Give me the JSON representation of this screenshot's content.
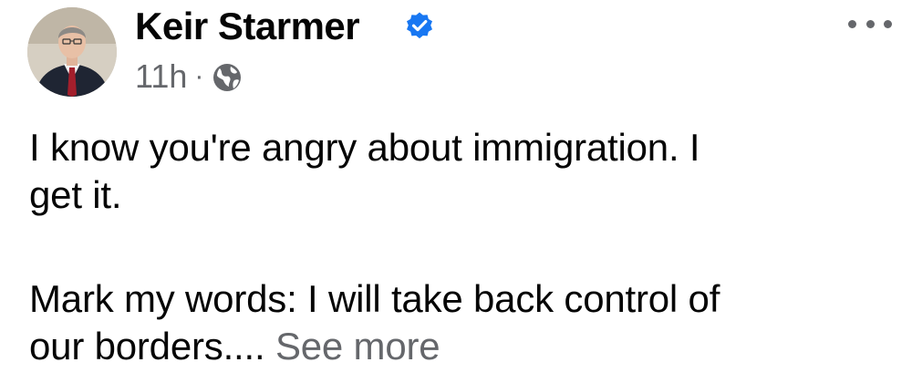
{
  "post": {
    "author_name": "Keir Starmer",
    "verified_icon": "verified-badge-icon",
    "verified_color": "#1877f2",
    "timestamp": "11h",
    "separator": "·",
    "audience_icon": "globe-icon",
    "more_icon": "more-options-icon",
    "text_lines": [
      "I know you're angry about immigration. I",
      "get it.",
      "Mark my words: I will take back control of",
      "our borders.... "
    ],
    "see_more_label": "See more"
  },
  "colors": {
    "text": "#050505",
    "secondary": "#65676b",
    "accent": "#1877f2"
  }
}
